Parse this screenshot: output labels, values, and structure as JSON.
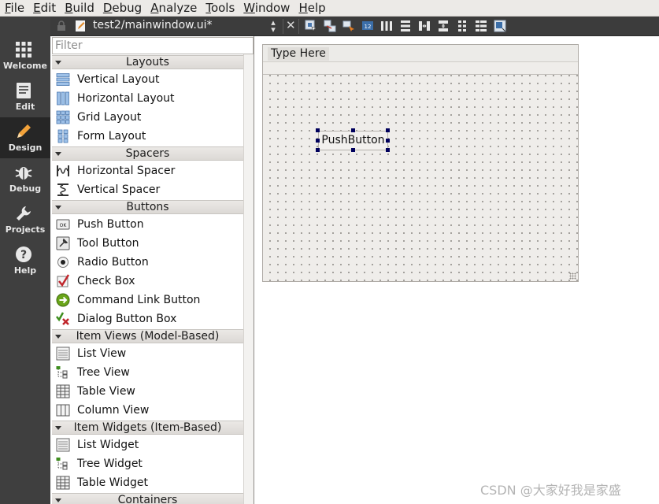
{
  "menubar": {
    "items": [
      {
        "mnemonic": "F",
        "rest": "ile"
      },
      {
        "mnemonic": "E",
        "rest": "dit"
      },
      {
        "mnemonic": "B",
        "rest": "uild"
      },
      {
        "mnemonic": "D",
        "rest": "ebug"
      },
      {
        "mnemonic": "A",
        "rest": "nalyze"
      },
      {
        "mnemonic": "T",
        "rest": "ools"
      },
      {
        "mnemonic": "W",
        "rest": "indow"
      },
      {
        "mnemonic": "H",
        "rest": "elp"
      }
    ]
  },
  "modes": [
    {
      "label": "Welcome",
      "icon": "grid-icon",
      "active": false
    },
    {
      "label": "Edit",
      "icon": "document-icon",
      "active": false
    },
    {
      "label": "Design",
      "icon": "pencil-icon",
      "active": true
    },
    {
      "label": "Debug",
      "icon": "bug-icon",
      "active": false
    },
    {
      "label": "Projects",
      "icon": "wrench-icon",
      "active": false
    },
    {
      "label": "Help",
      "icon": "question-icon",
      "active": false
    }
  ],
  "editor": {
    "tab_title": "test2/mainwindow.ui*",
    "toolbar_icons": [
      "edit-widgets-icon",
      "edit-signals-icon",
      "edit-buddies-icon",
      "edit-tab-order-icon",
      "layout-horizontal-icon",
      "layout-vertical-icon",
      "layout-h-splitter-icon",
      "layout-v-splitter-icon",
      "layout-grid-icon",
      "layout-form-icon",
      "adjust-size-icon"
    ]
  },
  "widget_box": {
    "filter_placeholder": "Filter",
    "categories": {
      "layouts": "Layouts",
      "spacers": "Spacers",
      "buttons": "Buttons",
      "item_views": "Item Views (Model-Based)",
      "item_widgets": "Item Widgets (Item-Based)",
      "containers": "Containers"
    },
    "items": {
      "vertical_layout": "Vertical Layout",
      "horizontal_layout": "Horizontal Layout",
      "grid_layout": "Grid Layout",
      "form_layout": "Form Layout",
      "horizontal_spacer": "Horizontal Spacer",
      "vertical_spacer": "Vertical Spacer",
      "push_button": "Push Button",
      "tool_button": "Tool Button",
      "radio_button": "Radio Button",
      "check_box": "Check Box",
      "command_link_button": "Command Link Button",
      "dialog_button_box": "Dialog Button Box",
      "list_view": "List View",
      "tree_view": "Tree View",
      "table_view": "Table View",
      "column_view": "Column View",
      "list_widget": "List Widget",
      "tree_widget": "Tree Widget",
      "table_widget": "Table Widget"
    },
    "ok_icon_text": "OK"
  },
  "form": {
    "menubar_placeholder": "Type Here",
    "push_button_text": "PushButton"
  },
  "watermark": "CSDN @大家好我是家盛",
  "colors": {
    "modebar": "#3f3f3f",
    "modebar_active": "#262626",
    "selection_handle": "#00005c"
  }
}
